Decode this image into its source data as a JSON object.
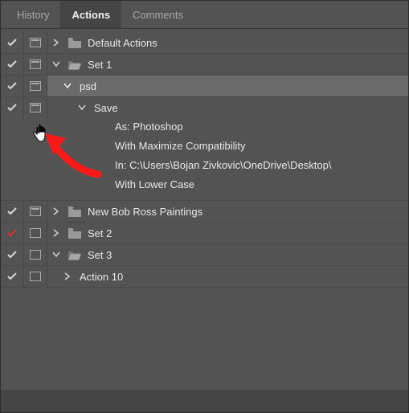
{
  "tabs": {
    "history": "History",
    "actions": "Actions",
    "comments": "Comments",
    "active": "Actions"
  },
  "rows": {
    "default_actions": "Default Actions",
    "set1": "Set 1",
    "psd": "psd",
    "save": "Save",
    "save_details": {
      "as": "As: Photoshop",
      "compat": "With Maximize Compatibility",
      "in": "In: C:\\Users\\Bojan Zivkovic\\OneDrive\\Desktop\\",
      "lower": "With Lower Case"
    },
    "new_bob": "New Bob Ross Paintings",
    "set2": "Set 2",
    "set3": "Set 3",
    "action10": "Action 10"
  }
}
